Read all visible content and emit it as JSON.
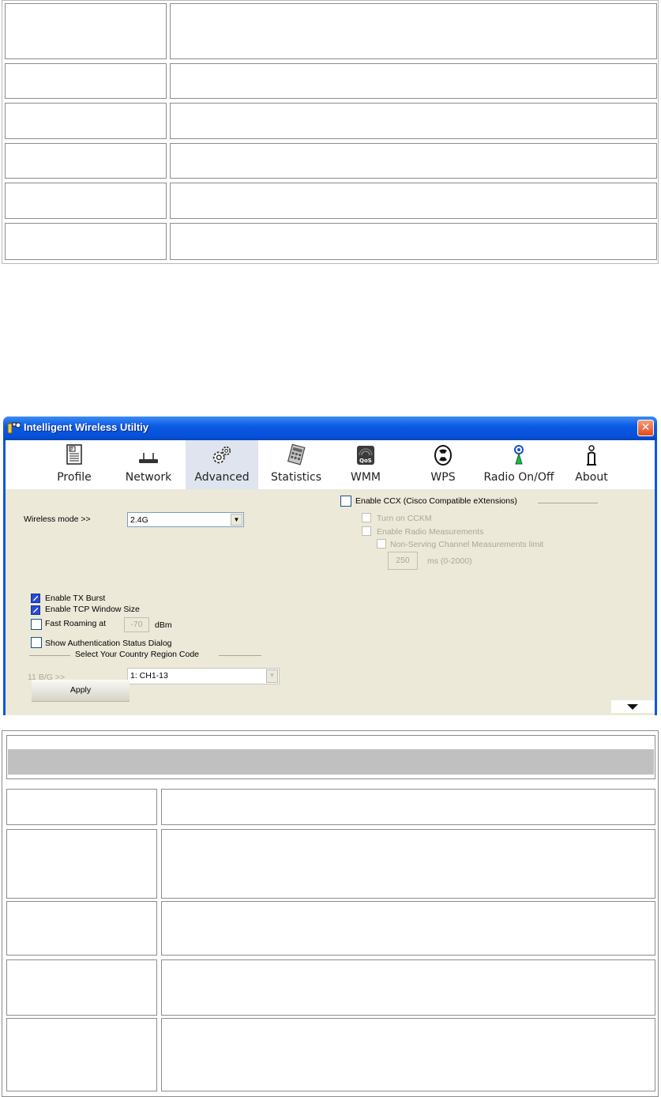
{
  "window": {
    "title": "Intelligent Wireless Utiltiy",
    "close_label": "✕"
  },
  "toolbar": {
    "items": [
      {
        "label": "Profile",
        "icon": "profile-icon"
      },
      {
        "label": "Network",
        "icon": "network-icon"
      },
      {
        "label": "Advanced",
        "icon": "advanced-gears-icon",
        "active": true
      },
      {
        "label": "Statistics",
        "icon": "statistics-icon"
      },
      {
        "label": "WMM",
        "icon": "wmm-qos-icon"
      },
      {
        "label": "WPS",
        "icon": "wps-icon"
      },
      {
        "label": "Radio On/Off",
        "icon": "radio-antenna-icon"
      },
      {
        "label": "About",
        "icon": "about-icon"
      }
    ]
  },
  "advanced": {
    "wireless_mode_label": "Wireless mode >>",
    "wireless_mode_value": "2.4G",
    "enable_tx_burst": {
      "label": "Enable TX Burst",
      "checked": true
    },
    "enable_tcp_window": {
      "label": "Enable TCP Window Size",
      "checked": true
    },
    "fast_roaming": {
      "label": "Fast Roaming at",
      "checked": false,
      "value": "-70",
      "unit": "dBm"
    },
    "show_auth_dialog": {
      "label": "Show Authentication Status Dialog",
      "checked": false
    },
    "country_region_header": "Select Your Country Region Code",
    "band_label": "11 B/G >>",
    "region_value": "1: CH1-13",
    "ccx": {
      "enable_label": "Enable CCX (Cisco Compatible eXtensions)",
      "cckm_label": "Turn on CCKM",
      "radio_measure_label": "Enable Radio Measurements",
      "non_serving_label": "Non-Serving Channel Measurements limit",
      "limit_value": "250",
      "limit_unit": "ms (0-2000)"
    },
    "apply_label": "Apply"
  },
  "colors": {
    "titlebar": "#0b5ae4",
    "panel": "#ece9d8",
    "active_tab": "#dfe4ef",
    "table_header": "#c0c0c0"
  }
}
